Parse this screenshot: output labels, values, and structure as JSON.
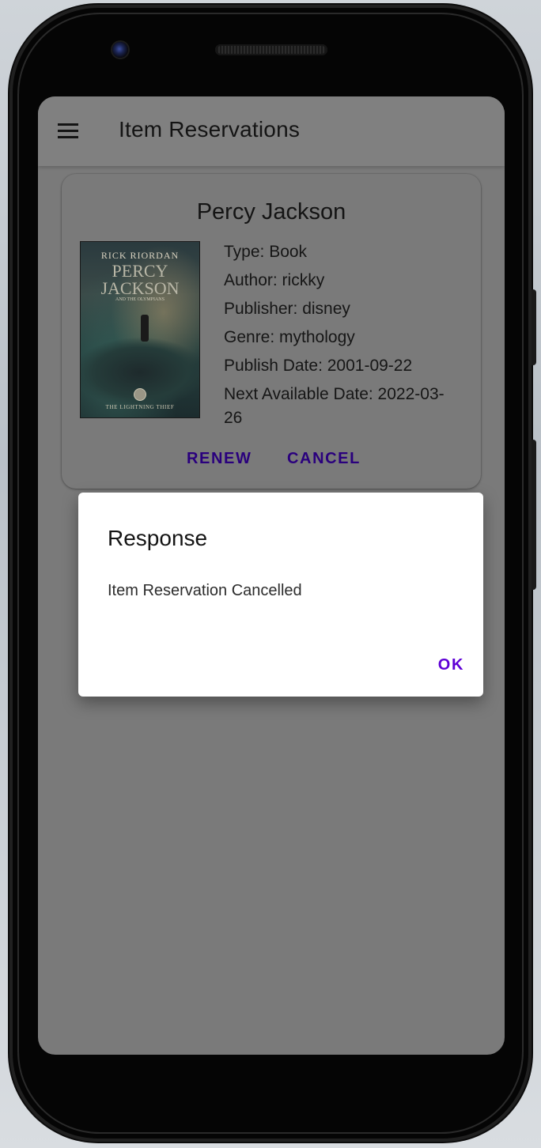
{
  "app_bar": {
    "title": "Item Reservations",
    "menu_icon": "hamburger-menu-icon"
  },
  "reservation": {
    "title": "Percy Jackson",
    "cover": {
      "author_text": "RICK RIORDAN",
      "title_text": "PERCY JACKSON",
      "subtitle_text": "AND THE OLYMPIANS",
      "footer_text": "THE LIGHTNING THIEF"
    },
    "details": [
      "Type: Book",
      "Author: rickky",
      "Publisher: disney",
      "Genre: mythology",
      "Publish Date: 2001-09-22",
      "Next Available Date: 2022-03-26"
    ],
    "actions": {
      "renew": "RENEW",
      "cancel": "CANCEL"
    }
  },
  "dialog": {
    "title": "Response",
    "message": "Item Reservation Cancelled",
    "ok": "OK"
  },
  "colors": {
    "button_text": "#2a007d",
    "dialog_ok": "#5e00d6",
    "scrim": "#7a7a7a"
  }
}
